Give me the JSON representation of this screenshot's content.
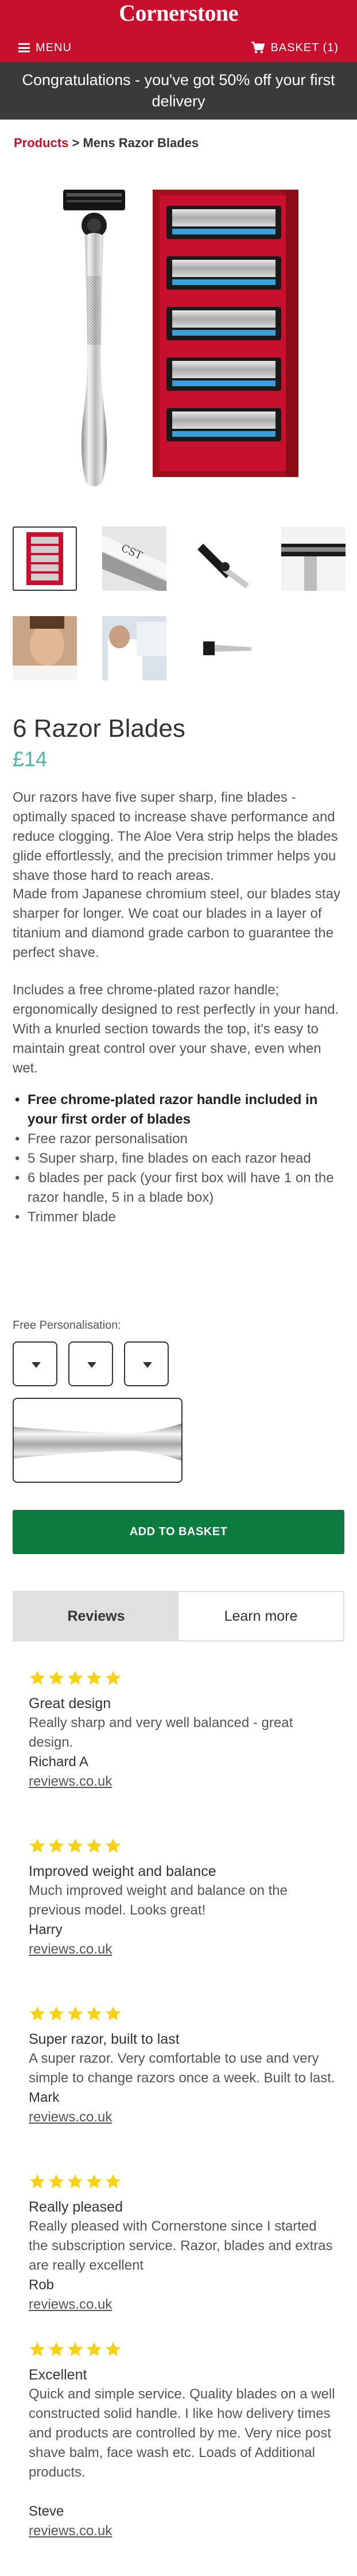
{
  "header": {
    "logo_text": "Cornerstone",
    "menu_label": "MENU",
    "basket_label": "BASKET (1)",
    "brand_color": "#c8102e"
  },
  "promo": {
    "text": "Congratulations - you've got 50% off your first delivery"
  },
  "breadcrumb": {
    "parent": "Products",
    "separator": " > ",
    "current": "Mens Razor Blades"
  },
  "product": {
    "title": "6 Razor Blades",
    "price": "£14",
    "paragraphs": [
      "Our razors have five super sharp, fine blades - optimally spaced to increase shave performance and reduce clogging. The Aloe Vera strip helps the blades glide effortlessly, and the precision trimmer helps you shave those hard to reach areas.",
      "Made from Japanese chromium steel, our blades stay sharper for longer. We coat our blades in a layer of titanium and diamond grade carbon to guarantee the perfect shave.",
      "Includes a free chrome-plated razor handle; ergonomically designed to rest perfectly in your hand. With a knurled section towards the top, it's easy to maintain great control over your shave, even when wet."
    ],
    "features": [
      "Free chrome-plated razor handle included in your first order of blades",
      "Free razor personalisation",
      "5 Super sharp, fine blades on each razor head",
      "6 blades per pack (your first box will have 1 on the razor handle, 5 in a blade box)",
      "Trimmer blade"
    ],
    "personalisation_label": "Free Personalisation:",
    "add_button": "ADD TO BASKET"
  },
  "tabs": [
    "Reviews",
    "Learn more"
  ],
  "reviews": [
    {
      "title": "Great design",
      "body": "Really sharp and very well balanced - great design.",
      "author": "Richard A",
      "source": "reviews.co.uk"
    },
    {
      "title": "Improved weight and balance",
      "body": "Much improved weight and balance on the previous model. Looks great!",
      "author": "Harry",
      "source": "reviews.co.uk"
    },
    {
      "title": "Super razor, built to last",
      "body": "A super razor. Very comfortable to use and very simple to change razors once a week. Built to last.",
      "author": "Mark",
      "source": "reviews.co.uk"
    },
    {
      "title": "Really pleased",
      "body": "Really pleased with Cornerstone since I started the subscription service. Razor, blades and extras are really excellent",
      "author": "Rob",
      "source": "reviews.co.uk"
    },
    {
      "title": "Excellent",
      "body": "Quick and simple service. Quality blades on a well constructed solid handle. I like how delivery times and products are controlled by me. Very nice post shave balm, face wash etc. Loads of Additional products.",
      "author": "Steve",
      "source": "reviews.co.uk"
    }
  ],
  "review_rating": 5,
  "colors": {
    "accent_green": "#0b7c3e",
    "price_teal": "#4fb3a9",
    "star_yellow": "#f7d117"
  }
}
